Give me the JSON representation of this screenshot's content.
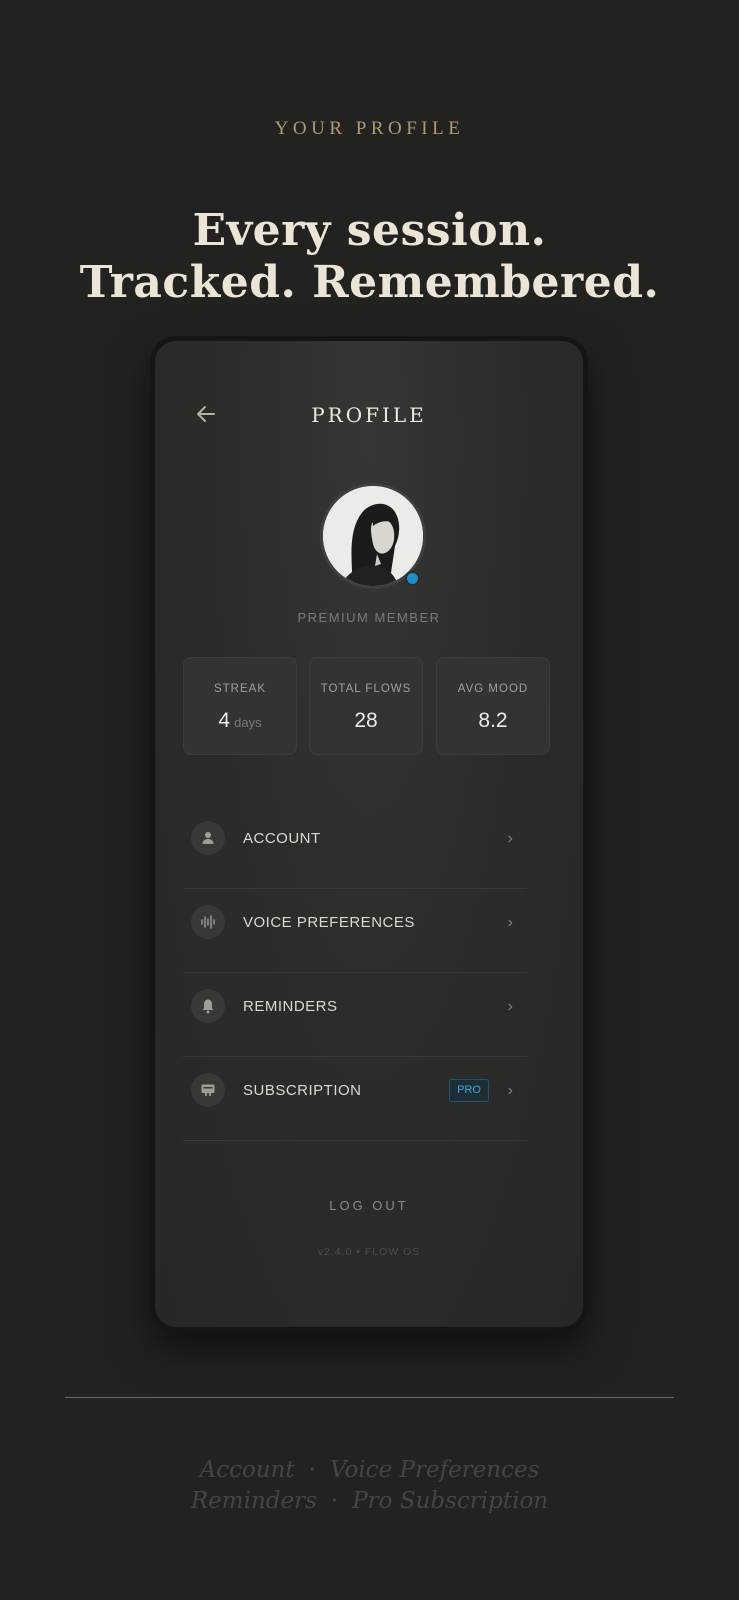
{
  "eyebrow": "YOUR PROFILE",
  "headline": {
    "line1": "Every session.",
    "line2": "Tracked. Remembered."
  },
  "screen": {
    "title": "PROFILE",
    "member_label": "PREMIUM MEMBER",
    "stats": [
      {
        "label": "STREAK",
        "value": "4",
        "unit": "days"
      },
      {
        "label": "TOTAL FLOWS",
        "value": "28"
      },
      {
        "label": "AVG MOOD",
        "value": "8.2"
      }
    ],
    "menu": [
      {
        "label": "ACCOUNT",
        "icon": "person-icon"
      },
      {
        "label": "VOICE PREFERENCES",
        "icon": "waveform-icon"
      },
      {
        "label": "REMINDERS",
        "icon": "bell-icon"
      },
      {
        "label": "SUBSCRIPTION",
        "icon": "card-icon",
        "badge": "PRO"
      }
    ],
    "logout": "LOG OUT",
    "version": "v2.4.0 • FLOW OS"
  },
  "footer": {
    "line1": [
      "Account",
      "Voice Preferences"
    ],
    "line2": [
      "Reminders",
      "Pro Subscription"
    ],
    "separator": "·"
  },
  "colors": {
    "background": "#222321",
    "accent_gold": "#b19a72",
    "headline": "#ece5d6",
    "status_blue": "#1a8fd0",
    "badge_blue": "#3aa6e0"
  }
}
